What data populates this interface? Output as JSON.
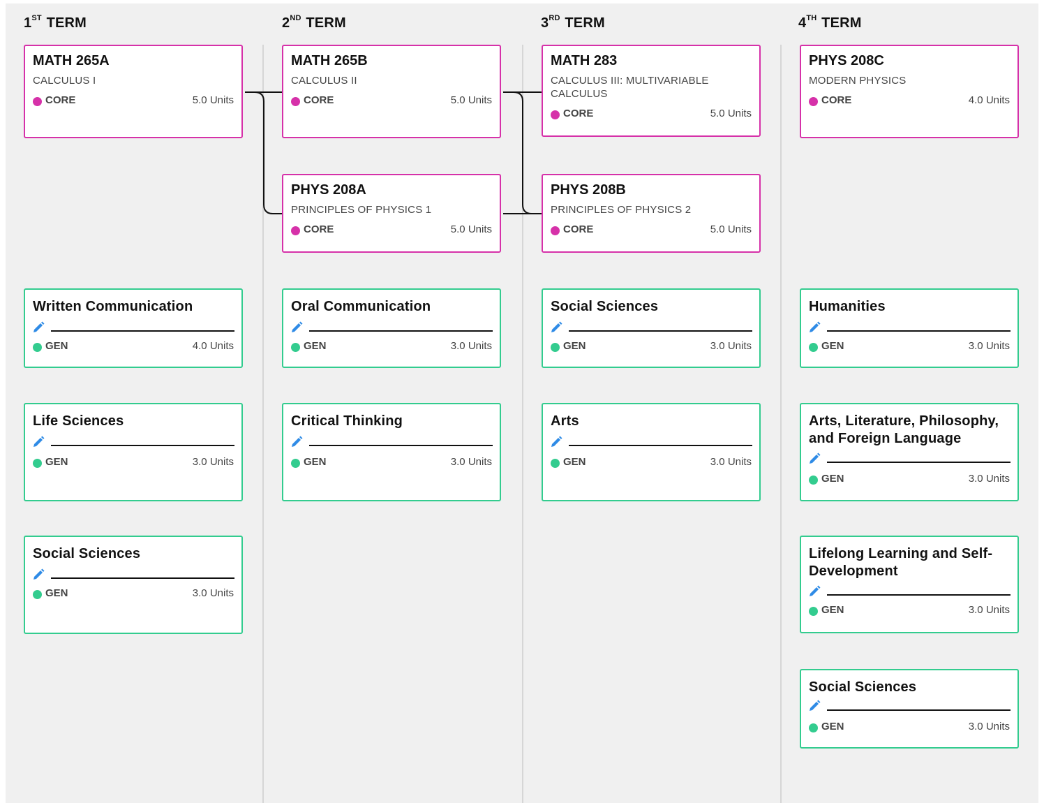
{
  "terms": [
    {
      "num": "1",
      "sup": "ST",
      "label": "TERM"
    },
    {
      "num": "2",
      "sup": "ND",
      "label": "TERM"
    },
    {
      "num": "3",
      "sup": "RD",
      "label": "TERM"
    },
    {
      "num": "4",
      "sup": "TH",
      "label": "TERM"
    }
  ],
  "icons": {
    "edit": "pencil-icon",
    "category_marker": "dot"
  },
  "colors": {
    "core": "#d631a9",
    "gen": "#33cc8f",
    "edit_icon": "#2f8be6"
  },
  "courses": {
    "math265a": {
      "code": "MATH 265A",
      "name": "CALCULUS I",
      "tag": "CORE",
      "units": "5.0 Units"
    },
    "math265b": {
      "code": "MATH 265B",
      "name": "CALCULUS II",
      "tag": "CORE",
      "units": "5.0 Units"
    },
    "math283": {
      "code": "MATH 283",
      "name": "CALCULUS III: MULTIVARIABLE CALCULUS",
      "tag": "CORE",
      "units": "5.0 Units"
    },
    "phys208c": {
      "code": "PHYS 208C",
      "name": "MODERN PHYSICS",
      "tag": "CORE",
      "units": "4.0 Units"
    },
    "phys208a": {
      "code": "PHYS 208A",
      "name": "PRINCIPLES OF PHYSICS 1",
      "tag": "CORE",
      "units": "5.0 Units"
    },
    "phys208b": {
      "code": "PHYS 208B",
      "name": "PRINCIPLES OF PHYSICS 2",
      "tag": "CORE",
      "units": "5.0 Units"
    }
  },
  "gen_ed": {
    "t1_written": {
      "title": "Written Communication",
      "tag": "GEN",
      "units": "4.0 Units"
    },
    "t1_life": {
      "title": "Life Sciences",
      "tag": "GEN",
      "units": "3.0 Units"
    },
    "t1_social": {
      "title": "Social Sciences",
      "tag": "GEN",
      "units": "3.0 Units"
    },
    "t2_oral": {
      "title": "Oral Communication",
      "tag": "GEN",
      "units": "3.0 Units"
    },
    "t2_critical": {
      "title": "Critical Thinking",
      "tag": "GEN",
      "units": "3.0 Units"
    },
    "t3_social": {
      "title": "Social Sciences",
      "tag": "GEN",
      "units": "3.0 Units"
    },
    "t3_arts": {
      "title": "Arts",
      "tag": "GEN",
      "units": "3.0 Units"
    },
    "t4_humanities": {
      "title": "Humanities",
      "tag": "GEN",
      "units": "3.0 Units"
    },
    "t4_arts_lit": {
      "title": "Arts, Literature, Philosophy, and Foreign Language",
      "tag": "GEN",
      "units": "3.0 Units"
    },
    "t4_lifelong": {
      "title": "Lifelong Learning and Self-Development",
      "tag": "GEN",
      "units": "3.0 Units"
    },
    "t4_social": {
      "title": "Social Sciences",
      "tag": "GEN",
      "units": "3.0 Units"
    }
  }
}
